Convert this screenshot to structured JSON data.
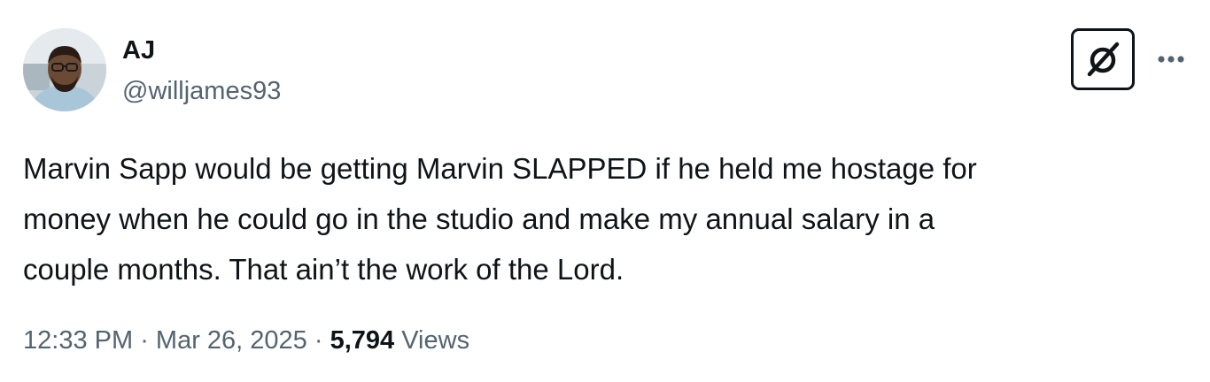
{
  "author": {
    "display_name": "AJ",
    "handle": "@willjames93"
  },
  "icons": {
    "avatar": "profile-photo",
    "grok": "grok-icon",
    "more": "more-dots-icon"
  },
  "tweet": {
    "text": "Marvin Sapp would be getting Marvin SLAPPED if he held me hostage for\nmoney when he could go in the studio and make my annual salary in a\ncouple months. That ain’t the work of the Lord."
  },
  "meta": {
    "time": "12:33 PM",
    "separator": " · ",
    "date": "Mar 26, 2025",
    "views_count": "5,794",
    "views_label": "Views"
  },
  "colors": {
    "text": "#0f1419",
    "secondary": "#536471",
    "background": "#ffffff"
  }
}
